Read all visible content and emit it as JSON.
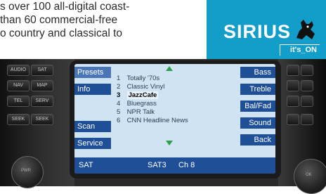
{
  "article": {
    "lines": [
      "s over 100 all-digital coast-",
      "than 60 commercial-free",
      "o country and classical to"
    ]
  },
  "logo": {
    "brand": "SIRIUS",
    "tagline": "it's_ON",
    "colors": {
      "background": "#139ec9",
      "text": "#ffffff"
    }
  },
  "hardware": {
    "left_buttons": [
      {
        "left": "AUDIO",
        "right": "SAT"
      },
      {
        "left": "NAV",
        "right": "MAP"
      },
      {
        "left": "TEL",
        "right": "SERV"
      },
      {
        "left": "SEEK",
        "right": "SEEK"
      }
    ],
    "left_knob": "PWR",
    "right_knob": "OK"
  },
  "screen": {
    "left_softkeys": [
      "Presets",
      "Info",
      "Scan",
      "Service"
    ],
    "right_softkeys": [
      "Bass",
      "Treble",
      "Bal/Fad",
      "Sound",
      "Back"
    ],
    "channels": [
      {
        "num": "1",
        "name": "Totally '70s"
      },
      {
        "num": "2",
        "name": "Classic Vinyl"
      },
      {
        "num": "3",
        "name": "JazzCafe"
      },
      {
        "num": "4",
        "name": "Bluegrass"
      },
      {
        "num": "5",
        "name": "NPR Talk"
      },
      {
        "num": "6",
        "name": "CNN Headline News"
      }
    ],
    "selected_channel_index": 2,
    "status": {
      "band": "SAT",
      "source": "SAT3",
      "channel": "Ch 8"
    },
    "colors": {
      "softkey": "#1f4f97",
      "display": "#cfe3f3",
      "arrow": "#2f9e4c"
    }
  }
}
